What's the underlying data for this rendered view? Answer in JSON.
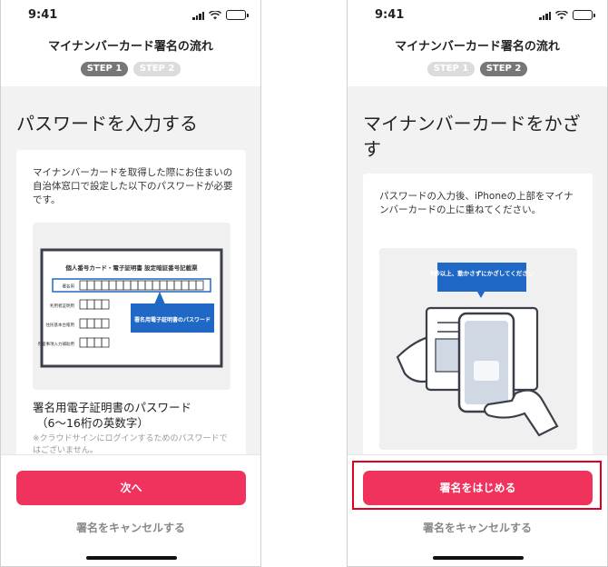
{
  "status_bar": {
    "time": "9:41"
  },
  "screens": [
    {
      "nav_title": "マイナンバーカード署名の流れ",
      "steps": [
        "STEP 1",
        "STEP 2"
      ],
      "heading": "パスワードを入力する",
      "description": "マイナンバーカードを取得した際にお住まいの自治体窓口で設定した以下のパスワードが必要です。",
      "form": {
        "title": "個人番号カード・電子証明書 設定暗証番号記載票",
        "rows": [
          "署名用",
          "利用者証明用",
          "住民基本台帳用",
          "券面事項入力補助用"
        ],
        "callout": "署名用電子証明書のパスワード"
      },
      "password_label": "署名用電子証明書のパスワード",
      "password_sub": "（6〜16桁の英数字）",
      "note": "※クラウドサインにログインするためのパスワードではございません。",
      "primary_button": "次へ",
      "cancel": "署名をキャンセルする"
    },
    {
      "nav_title": "マイナンバーカード署名の流れ",
      "steps": [
        "STEP 1",
        "STEP 2"
      ],
      "heading": "マイナンバーカードをかざす",
      "description": "パスワードの入力後、iPhoneの上部をマイナンバーカードの上に重ねてください。",
      "callout": "5秒以上、動かさずにかざしてください",
      "primary_button": "署名をはじめる",
      "cancel": "署名をキャンセルする"
    }
  ],
  "colors": {
    "accent": "#f0335c",
    "highlight": "#e0001b",
    "callout_blue": "#1f68c5"
  }
}
